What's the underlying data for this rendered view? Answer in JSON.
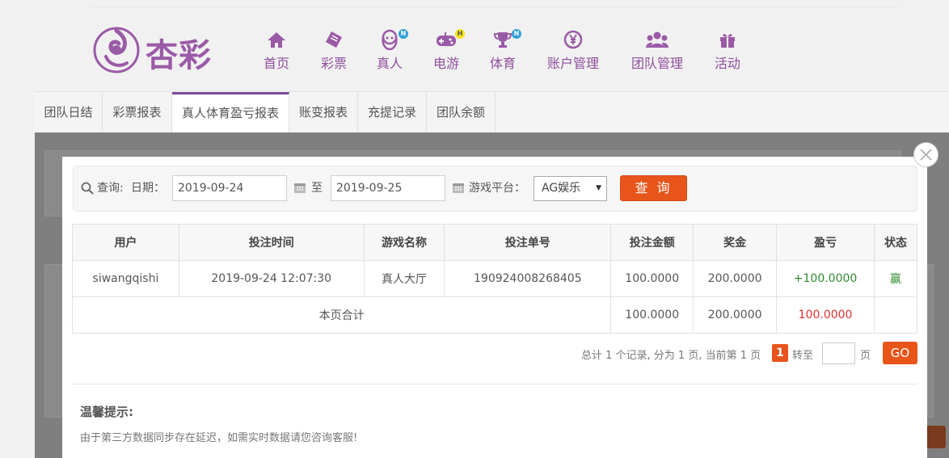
{
  "logo": {
    "text": "杏彩"
  },
  "nav": [
    {
      "label": "首页",
      "icon": "home-icon",
      "badge": ""
    },
    {
      "label": "彩票",
      "icon": "lottery-icon",
      "badge": ""
    },
    {
      "label": "真人",
      "icon": "live-dealer-icon",
      "badge": "N"
    },
    {
      "label": "电游",
      "icon": "gamepad-icon",
      "badge": "H"
    },
    {
      "label": "体育",
      "icon": "trophy-icon",
      "badge": "N"
    },
    {
      "label": "账户管理",
      "icon": "yen-coin-icon",
      "badge": ""
    },
    {
      "label": "团队管理",
      "icon": "team-icon",
      "badge": ""
    },
    {
      "label": "活动",
      "icon": "gift-icon",
      "badge": ""
    }
  ],
  "tabs": [
    "团队日结",
    "彩票报表",
    "真人体育盈亏报表",
    "账变报表",
    "充提记录",
    "团队余额"
  ],
  "active_tab": "真人体育盈亏报表",
  "search": {
    "query_label": "查询:",
    "date_label": "日期：",
    "date_from": "2019-09-24",
    "to_label": "至",
    "date_to": "2019-09-25",
    "platform_label": "游戏平台：",
    "platform_value": "AG娱乐",
    "query_button": "查 询"
  },
  "table": {
    "headers": [
      "用户",
      "投注时间",
      "游戏名称",
      "投注单号",
      "投注金额",
      "奖金",
      "盈亏",
      "状态"
    ],
    "rows": [
      [
        "siwangqishi",
        "2019-09-24 12:07:30",
        "真人大厅",
        "190924008268405",
        "100.0000",
        "200.0000",
        "+100.0000",
        "赢"
      ]
    ],
    "summary": {
      "label": "本页合计",
      "bet": "100.0000",
      "bonus": "200.0000",
      "profit": "100.0000"
    }
  },
  "pager": {
    "info": "总计 1 个记录, 分为 1 页, 当前第 1 页",
    "current": "1",
    "goto_label": "转至",
    "page_label": "页",
    "go_button": "GO"
  },
  "tips": {
    "title": "温馨提示:",
    "text": "由于第三方数据同步存在延迟，如需实时数据请您咨询客服!"
  },
  "colors": {
    "brand": "#8e4f9c",
    "accent": "#e8551a",
    "win": "#2e8a2e",
    "loss": "#e23030"
  }
}
